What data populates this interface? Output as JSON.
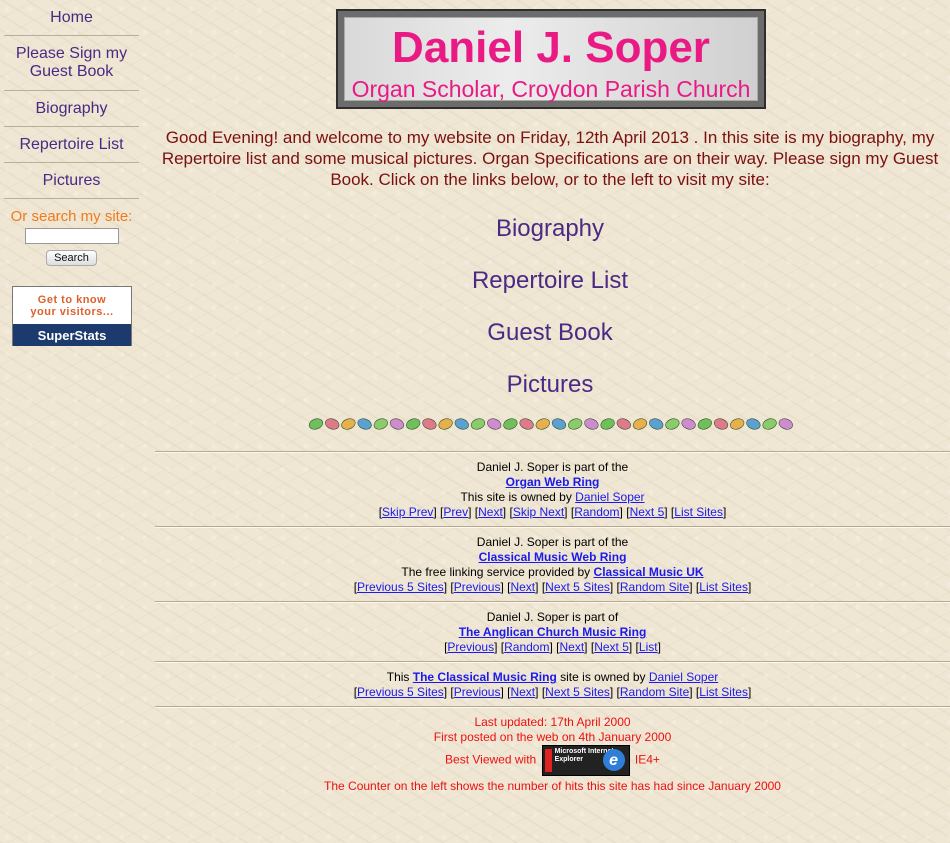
{
  "sidebar": {
    "items": [
      {
        "label": "Home"
      },
      {
        "label": "Please Sign my Guest Book"
      },
      {
        "label": "Biography"
      },
      {
        "label": "Repertoire List"
      },
      {
        "label": "Pictures"
      }
    ],
    "search_label": "Or search my site:",
    "search_value": "",
    "search_button": "Search",
    "superstats": {
      "top_line1": "Get to know",
      "top_line2": "your visitors...",
      "bottom": "SuperStats"
    }
  },
  "header": {
    "title": "Daniel J. Soper",
    "subtitle": "Organ Scholar, Croydon Parish Church"
  },
  "welcome_text": "Good Evening! and welcome to my website on Friday, 12th April 2013 . In this site is my biography, my Repertoire list and some musical pictures. Organ Specifications are on their way. Please sign my Guest Book. Click on the links below, or to the left to visit my site:",
  "main_links": [
    "Biography",
    "Repertoire List",
    "Guest Book",
    "Pictures"
  ],
  "rings": {
    "organ": {
      "line1": "Daniel J. Soper is part of the",
      "ring_name": "Organ Web Ring",
      "owned_prefix": "This site is owned by",
      "owner": "Daniel Soper",
      "nav": [
        "Skip Prev",
        "Prev",
        "Next",
        "Skip Next",
        "Random",
        "Next 5",
        "List Sites"
      ]
    },
    "classical": {
      "line1": "Daniel J. Soper is part of the",
      "ring_name": "Classical Music Web Ring",
      "provider_prefix": "The free linking service provided by",
      "provider": "Classical Music UK",
      "nav": [
        "Previous 5 Sites",
        "Previous",
        "Next",
        "Next 5 Sites",
        "Random Site",
        "List Sites"
      ]
    },
    "anglican": {
      "line1": "Daniel J. Soper is part of",
      "ring_name": "The Anglican Church Music Ring",
      "nav": [
        "Previous",
        "Random",
        "Next",
        "Next 5",
        "List"
      ]
    },
    "cmring": {
      "prefix": "This",
      "ring_name": "The Classical Music Ring",
      "middle": "site is owned by",
      "owner": "Daniel Soper",
      "nav": [
        "Previous 5 Sites",
        "Previous",
        "Next",
        "Next 5 Sites",
        "Random Site",
        "List Sites"
      ]
    }
  },
  "footer": {
    "updated": "Last updated: 17th April 2000",
    "posted": "First posted on the web on 4th January 2000",
    "best_viewed": "Best Viewed with",
    "ie_label": "IE4+",
    "ie_badge_text": "Microsoft Internet Explorer",
    "counter_note": "The Counter on the left shows the number of hits this site has had since January 2000"
  },
  "colors": {
    "title": "#ea1a85",
    "nav": "#4a2a84",
    "welcome": "#7a1010",
    "footer": "#ee1111",
    "link": "#1a1aee"
  }
}
